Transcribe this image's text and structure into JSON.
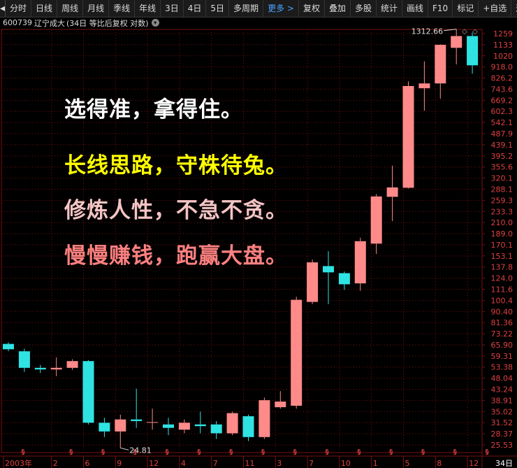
{
  "toolbar": {
    "back_icon": "back-arrow-icon",
    "items": [
      "分时",
      "日线",
      "周线",
      "月线",
      "季线",
      "年线",
      "3日",
      "4日",
      "5日",
      "多周期",
      "更多 >",
      "复权",
      "叠加",
      "多股",
      "统计",
      "画线",
      "F10",
      "标记",
      "+自选",
      "返回"
    ],
    "active_index": 10
  },
  "info": {
    "code": "600739",
    "name": "辽宁成大",
    "desc": "(34日 等比后复权 对数)"
  },
  "slogans": [
    "选得准，拿得住。",
    "长线思路，守株待兔。",
    "修炼人性，不急不贪。",
    "慢慢赚钱，跑赢大盘。"
  ],
  "colors": {
    "up": "#ff8a8a",
    "down": "#2fe3e3",
    "grid": "#7a1010",
    "axis_text": "#e04040",
    "label": "#e0e0e0"
  },
  "chart_data": {
    "type": "candlestick",
    "scale": "log",
    "y_ticks": [
      "1259",
      "1133",
      "1020",
      "918.0",
      "826.2",
      "743.6",
      "669.2",
      "602.3",
      "542.1",
      "487.9",
      "439.1",
      "395.2",
      "355.6",
      "320.1",
      "288.1",
      "259.3",
      "233.3",
      "210.0",
      "189.0",
      "170.1",
      "153.1",
      "137.8",
      "124.0",
      "111.6",
      "100.4",
      "90.40",
      "81.36",
      "73.22",
      "65.90",
      "59.31",
      "53.38",
      "48.04",
      "43.24",
      "38.91",
      "35.02",
      "31.52",
      "28.37",
      "25.53"
    ],
    "x_ticks": [
      "2003年",
      "2",
      "6",
      "9",
      "12",
      "4",
      "7",
      "11",
      "3",
      "7",
      "10",
      "1",
      "5",
      "8",
      "12"
    ],
    "x_tick_candle": [
      0,
      3,
      5,
      7,
      9,
      11,
      13,
      15,
      17,
      19,
      21,
      23,
      25,
      27,
      29
    ],
    "period_label": "34日",
    "max_label": "1312.66",
    "min_label": "24.81",
    "candles": [
      {
        "o": 66.5,
        "c": 63.2,
        "h": 67.5,
        "l": 62.0
      },
      {
        "o": 62.0,
        "c": 53.0,
        "h": 63.5,
        "l": 51.0
      },
      {
        "o": 53.0,
        "c": 52.2,
        "h": 54.5,
        "l": 50.5
      },
      {
        "o": 52.2,
        "c": 53.0,
        "h": 58.5,
        "l": 49.0
      },
      {
        "o": 53.0,
        "c": 56.5,
        "h": 57.5,
        "l": 52.0
      },
      {
        "o": 56.5,
        "c": 31.5,
        "h": 57.0,
        "l": 31.0
      },
      {
        "o": 31.5,
        "c": 29.0,
        "h": 33.0,
        "l": 27.5
      },
      {
        "o": 29.0,
        "c": 32.5,
        "h": 34.0,
        "l": 24.81
      },
      {
        "o": 32.5,
        "c": 32.0,
        "h": 43.5,
        "l": 30.0
      },
      {
        "o": 31.5,
        "c": 31.7,
        "h": 36.0,
        "l": 29.5
      },
      {
        "o": 31.0,
        "c": 30.0,
        "h": 33.0,
        "l": 28.0
      },
      {
        "o": 29.5,
        "c": 31.5,
        "h": 32.5,
        "l": 28.5
      },
      {
        "o": 31.0,
        "c": 30.5,
        "h": 35.0,
        "l": 28.5
      },
      {
        "o": 31.0,
        "c": 28.5,
        "h": 32.0,
        "l": 27.0
      },
      {
        "o": 28.5,
        "c": 34.5,
        "h": 35.0,
        "l": 28.0
      },
      {
        "o": 33.5,
        "c": 27.5,
        "h": 34.0,
        "l": 26.5
      },
      {
        "o": 27.5,
        "c": 39.0,
        "h": 40.0,
        "l": 27.0
      },
      {
        "o": 36.5,
        "c": 38.5,
        "h": 42.5,
        "l": 36.0
      },
      {
        "o": 37.0,
        "c": 101.0,
        "h": 104.0,
        "l": 36.0
      },
      {
        "o": 99.0,
        "c": 144.0,
        "h": 148.0,
        "l": 97.0
      },
      {
        "o": 139.0,
        "c": 131.0,
        "h": 160.0,
        "l": 97.0
      },
      {
        "o": 130.0,
        "c": 117.0,
        "h": 132.0,
        "l": 111.0
      },
      {
        "o": 118.0,
        "c": 176.0,
        "h": 182.0,
        "l": 110.0
      },
      {
        "o": 172.0,
        "c": 269.0,
        "h": 275.0,
        "l": 156.0
      },
      {
        "o": 268.0,
        "c": 293.0,
        "h": 360.0,
        "l": 213.0
      },
      {
        "o": 292.0,
        "c": 766.0,
        "h": 800.0,
        "l": 290.0
      },
      {
        "o": 750.0,
        "c": 785.0,
        "h": 968.0,
        "l": 606.0
      },
      {
        "o": 785.0,
        "c": 1132.0,
        "h": 1137.0,
        "l": 680.0
      },
      {
        "o": 1100.0,
        "c": 1230.0,
        "h": 1312.66,
        "l": 940.0
      },
      {
        "o": 1230.0,
        "c": 932.0,
        "h": 1270.0,
        "l": 860.0
      }
    ]
  }
}
